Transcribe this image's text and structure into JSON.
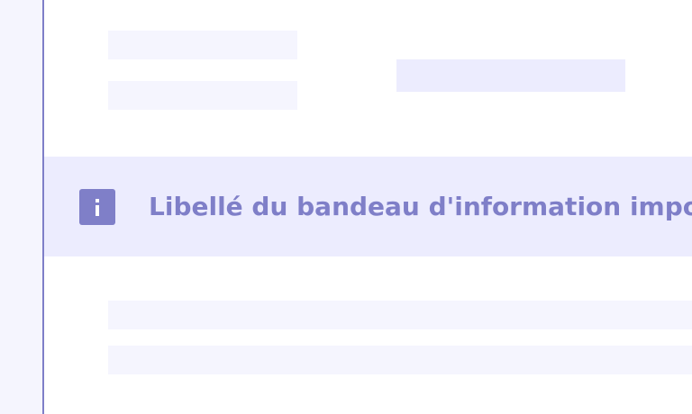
{
  "notice": {
    "icon": "info-icon",
    "text": "Libellé du bandeau d'information importante"
  },
  "colors": {
    "accent": "#7f7fc8",
    "notice_background": "#ececfe",
    "placeholder_background": "#f5f5fe",
    "page_background": "#ffffff"
  }
}
